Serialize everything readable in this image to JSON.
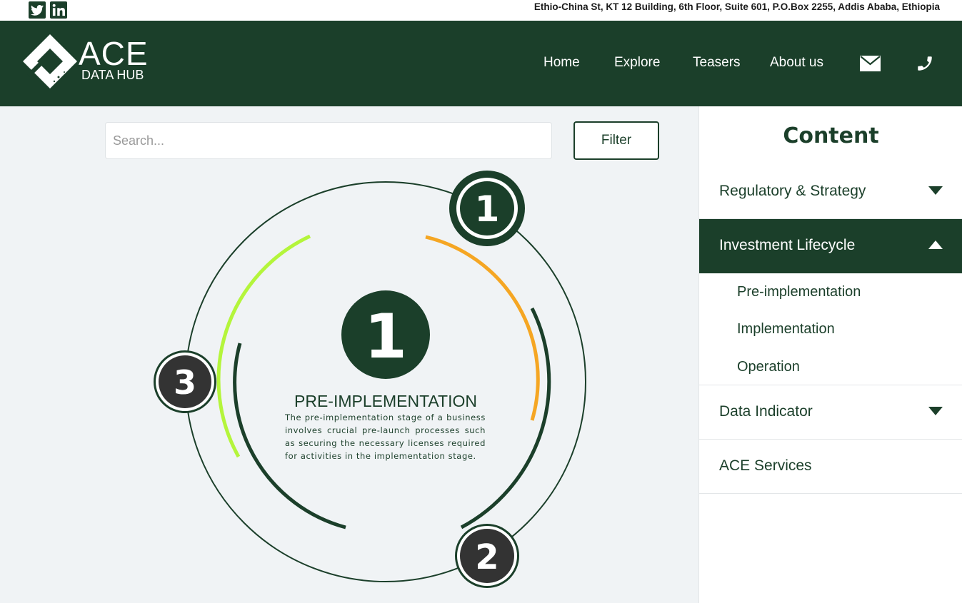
{
  "topbar": {
    "address": "Ethio-China St, KT 12 Building, 6th Floor, Suite 601, P.O.Box 2255, Addis Ababa, Ethiopia",
    "social": [
      {
        "icon": "twitter-icon"
      },
      {
        "icon": "linkedin-icon"
      }
    ]
  },
  "header": {
    "logo_main": "ACE",
    "logo_sub": "DATA HUB",
    "nav": [
      "Home",
      "Explore",
      "Teasers",
      "About us"
    ],
    "icons": [
      "mail-icon",
      "phone-icon"
    ]
  },
  "search": {
    "placeholder": "Search...",
    "value": ""
  },
  "filter_label": "Filter",
  "diagram": {
    "center_number": "1",
    "stage_title": "PRE-IMPLEMENTATION",
    "stage_description": "The pre-implementation stage of a business involves crucial pre-launch processes such as securing the necessary licenses required for activities in the implementation stage.",
    "stages": [
      {
        "number": "1",
        "active": true
      },
      {
        "number": "2",
        "active": false
      },
      {
        "number": "3",
        "active": false
      }
    ],
    "colors": {
      "dark_green": "#1b3f2a",
      "orange": "#f5a623",
      "lime": "#b4f53b",
      "badge": "#333333"
    }
  },
  "sidebar": {
    "title": "Content",
    "sections": [
      {
        "label": "Regulatory & Strategy",
        "expanded": false
      },
      {
        "label": "Investment Lifecycle",
        "expanded": true,
        "items": [
          "Pre-implementation",
          "Implementation",
          "Operation"
        ]
      },
      {
        "label": "Data Indicator",
        "expanded": false
      },
      {
        "label": "ACE Services",
        "expanded": false
      }
    ]
  }
}
